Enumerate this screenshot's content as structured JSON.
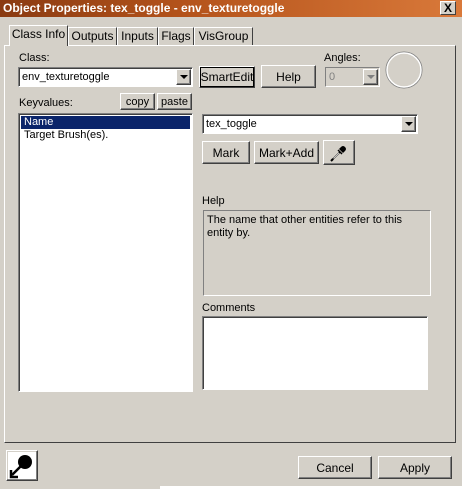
{
  "window": {
    "title": "Object Properties: tex_toggle - env_texturetoggle",
    "close_glyph": "X"
  },
  "tabs": [
    {
      "label": "Class Info",
      "active": true
    },
    {
      "label": "Outputs",
      "active": false
    },
    {
      "label": "Inputs",
      "active": false
    },
    {
      "label": "Flags",
      "active": false
    },
    {
      "label": "VisGroup",
      "active": false
    }
  ],
  "class_section": {
    "label": "Class:",
    "selected_class": "env_texturetoggle",
    "smartedit_label": "SmartEdit",
    "help_label": "Help"
  },
  "angles": {
    "label": "Angles:",
    "value": "0",
    "enabled": false
  },
  "keyvalues": {
    "label": "Keyvalues:",
    "copy_label": "copy",
    "paste_label": "paste",
    "items": [
      {
        "label": "Name",
        "selected": true
      },
      {
        "label": "Target Brush(es).",
        "selected": false
      }
    ]
  },
  "value_editor": {
    "value": "tex_toggle",
    "mark_label": "Mark",
    "mark_add_label": "Mark+Add",
    "picker_icon": "eyedropper-icon"
  },
  "help_section": {
    "label": "Help",
    "text": "The name that other entities refer to this entity by."
  },
  "comments_section": {
    "label": "Comments",
    "text": ""
  },
  "footer": {
    "cancel_label": "Cancel",
    "apply_label": "Apply",
    "pin_icon": "pushpin-icon"
  },
  "colors": {
    "face": "#d4d0c8",
    "selection": "#0a246a",
    "title_gradient_start": "#8a3b12",
    "title_gradient_end": "#d9793a"
  }
}
